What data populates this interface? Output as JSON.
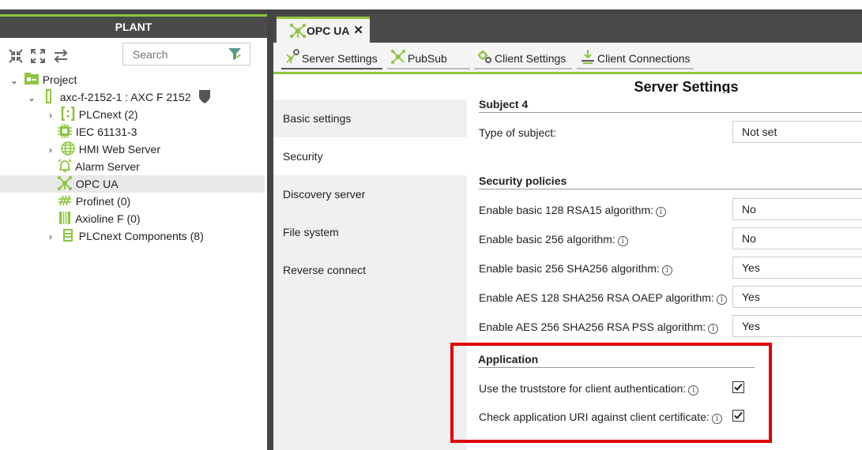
{
  "plant": {
    "header": "PLANT",
    "search_placeholder": "Search",
    "tree": [
      {
        "label": "Project"
      },
      {
        "label": "axc-f-2152-1 : AXC F 2152"
      },
      {
        "label": "PLCnext (2)"
      },
      {
        "label": "IEC 61131-3"
      },
      {
        "label": "HMI Web Server"
      },
      {
        "label": "Alarm Server"
      },
      {
        "label": "OPC UA"
      },
      {
        "label": "Profinet (0)"
      },
      {
        "label": "Axioline F (0)"
      },
      {
        "label": "PLCnext Components (8)"
      }
    ]
  },
  "editor": {
    "tab_label": "OPC UA",
    "close_glyph": "✕",
    "subtabs": [
      "Server Settings",
      "PubSub",
      "Client Settings",
      "Client Connections"
    ],
    "page_title": "Server Settings",
    "nav": [
      "Basic settings",
      "Security",
      "Discovery server",
      "File system",
      "Reverse connect"
    ],
    "subject": {
      "heading": "Subject 4",
      "type_label": "Type of subject:",
      "type_value": "Not set"
    },
    "policies": {
      "heading": "Security policies",
      "rows": [
        {
          "label": "Enable basic 128 RSA15 algorithm:",
          "value": "No"
        },
        {
          "label": "Enable basic 256 algorithm:",
          "value": "No"
        },
        {
          "label": "Enable basic 256 SHA256 algorithm:",
          "value": "Yes"
        },
        {
          "label": "Enable AES 128 SHA256 RSA OAEP algorithm:",
          "value": "Yes"
        },
        {
          "label": "Enable AES 256 SHA256 RSA PSS algorithm:",
          "value": "Yes"
        }
      ]
    },
    "application": {
      "heading": "Application",
      "rows": [
        {
          "label": "Use the truststore for client authentication:",
          "checked": true
        },
        {
          "label": "Check application URI against client certificate:",
          "checked": true
        }
      ]
    },
    "info_glyph": "i"
  },
  "colors": {
    "accent": "#8dc63f",
    "highlight": "#e00000",
    "dark": "#4a4a4a"
  }
}
